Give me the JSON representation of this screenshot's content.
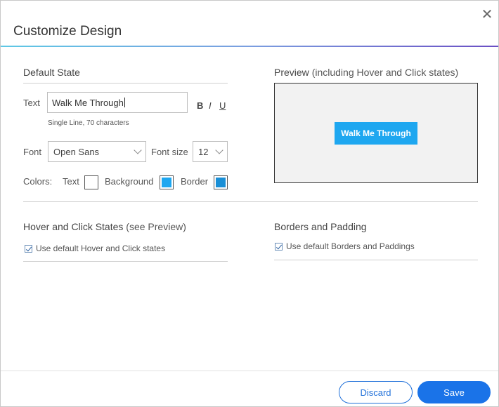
{
  "dialog": {
    "title": "Customize Design",
    "close_icon": "close-icon"
  },
  "default_state": {
    "heading": "Default State",
    "text_label": "Text",
    "text_value": "Walk Me Through",
    "text_hint": "Single Line, 70 characters",
    "format": {
      "bold": "B",
      "italic": "I",
      "underline": "U"
    },
    "font_label": "Font",
    "font_value": "Open Sans",
    "font_size_label": "Font size",
    "font_size_value": "12",
    "colors_label": "Colors:",
    "color_text_label": "Text",
    "color_background_label": "Background",
    "color_border_label": "Border",
    "colors": {
      "text": "#ffffff",
      "background": "#1ea7f0",
      "border": "#1a8fd6"
    }
  },
  "preview": {
    "heading": "Preview",
    "heading_sub": "(including Hover and Click states)",
    "button_label": "Walk Me Through"
  },
  "hover_click": {
    "heading": "Hover and Click States",
    "heading_sub": "(see Preview)",
    "checkbox_label": "Use default Hover and Click states",
    "checked": true
  },
  "borders_padding": {
    "heading": "Borders and Padding",
    "checkbox_label": "Use default Borders and Paddings",
    "checked": true
  },
  "footer": {
    "discard_label": "Discard",
    "save_label": "Save"
  },
  "accent_colors": {
    "primary": "#1a73e8",
    "preview_button": "#1ea7f0"
  }
}
